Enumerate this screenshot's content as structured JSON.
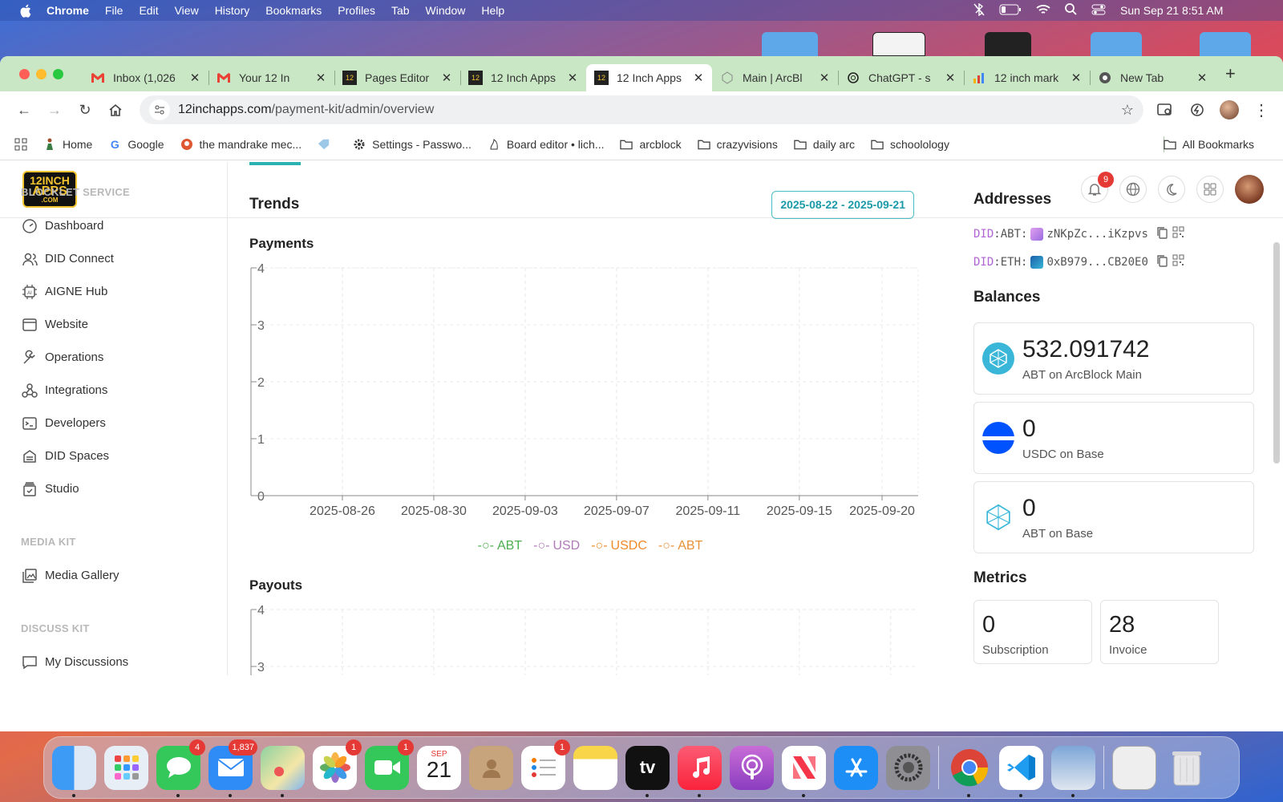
{
  "menubar": {
    "app": "Chrome",
    "items": [
      "File",
      "Edit",
      "View",
      "History",
      "Bookmarks",
      "Profiles",
      "Tab",
      "Window",
      "Help"
    ],
    "datetime": "Sun Sep 21  8:51 AM"
  },
  "tabs": [
    {
      "title": "Inbox (1,026",
      "icon": "gmail-icon"
    },
    {
      "title": "Your 12 In",
      "icon": "gmail-icon"
    },
    {
      "title": "Pages Editor",
      "icon": "12inch-icon"
    },
    {
      "title": "12 Inch Apps",
      "icon": "12inch-icon"
    },
    {
      "title": "12 Inch Apps",
      "icon": "12inch-icon",
      "active": true
    },
    {
      "title": "Main | ArcBl",
      "icon": "arcblock-icon"
    },
    {
      "title": "ChatGPT - s",
      "icon": "chatgpt-icon"
    },
    {
      "title": "12 inch mark",
      "icon": "chart-icon"
    },
    {
      "title": "New Tab",
      "icon": "chrome-icon"
    }
  ],
  "address": {
    "host": "12inchapps.com",
    "path": "/payment-kit/admin/overview"
  },
  "bookmarks": [
    "Home",
    "Google",
    "the mandrake mec...",
    "",
    "Settings - Passwo...",
    "Board editor • lich...",
    "arcblock",
    "crazyvisions",
    "daily arc",
    "schoolology"
  ],
  "all_bookmarks": "All Bookmarks",
  "logo": {
    "line1": "12INCH",
    "line2": "APPS",
    "line3": ".COM"
  },
  "header": {
    "notifications": "9"
  },
  "sidebar": {
    "section1": "BLOCKLET SERVICE",
    "items1": [
      "Dashboard",
      "DID Connect",
      "AIGNE Hub",
      "Website",
      "Operations",
      "Integrations",
      "Developers",
      "DID Spaces",
      "Studio"
    ],
    "section2": "MEDIA KIT",
    "items2": [
      "Media Gallery"
    ],
    "section3": "DISCUSS KIT",
    "items3": [
      "My Discussions"
    ]
  },
  "main": {
    "trends_title": "Trends",
    "date_range": "2025-08-22 - 2025-09-21",
    "payments_title": "Payments",
    "payouts_title": "Payouts"
  },
  "chart_data": [
    {
      "type": "line",
      "title": "Payments",
      "x": [
        "2025-08-26",
        "2025-08-30",
        "2025-09-03",
        "2025-09-07",
        "2025-09-11",
        "2025-09-15",
        "2025-09-20"
      ],
      "ylim": [
        0,
        4
      ],
      "yticks": [
        "0",
        "1",
        "2",
        "3",
        "4"
      ],
      "grid": true,
      "legend_position": "bottom",
      "series": [
        {
          "name": "ABT",
          "color": "#4caf50",
          "values": []
        },
        {
          "name": "USD",
          "color": "#b07ab8",
          "values": []
        },
        {
          "name": "USDC",
          "color": "#ef8a2a",
          "values": []
        },
        {
          "name": "ABT",
          "color": "#e8913a",
          "values": []
        }
      ]
    },
    {
      "type": "line",
      "title": "Payouts",
      "ylim": [
        0,
        4
      ],
      "yticks": [
        "3",
        "4"
      ],
      "grid": true
    }
  ],
  "side": {
    "addresses_title": "Addresses",
    "addresses": [
      {
        "prefix": "DID",
        "chain": ":ABT:",
        "value": "zNKpZc...iKzpvs"
      },
      {
        "prefix": "DID",
        "chain": ":ETH:",
        "value": "0xB979...CB20E0"
      }
    ],
    "balances_title": "Balances",
    "balances": [
      {
        "value": "532.091742",
        "label": "ABT on ArcBlock Main"
      },
      {
        "value": "0",
        "label": "USDC on Base"
      },
      {
        "value": "0",
        "label": "ABT on Base"
      }
    ],
    "metrics_title": "Metrics",
    "metrics": [
      {
        "value": "0",
        "label": "Subscription"
      },
      {
        "value": "28",
        "label": "Invoice"
      }
    ]
  },
  "dock": {
    "messages_badge": "4",
    "mail_badge": "1,837",
    "photos_badge": "1",
    "facetime_badge": "1",
    "calendar_month": "SEP",
    "calendar_day": "21",
    "reminders_badge": "1",
    "tv_label": "tv"
  }
}
